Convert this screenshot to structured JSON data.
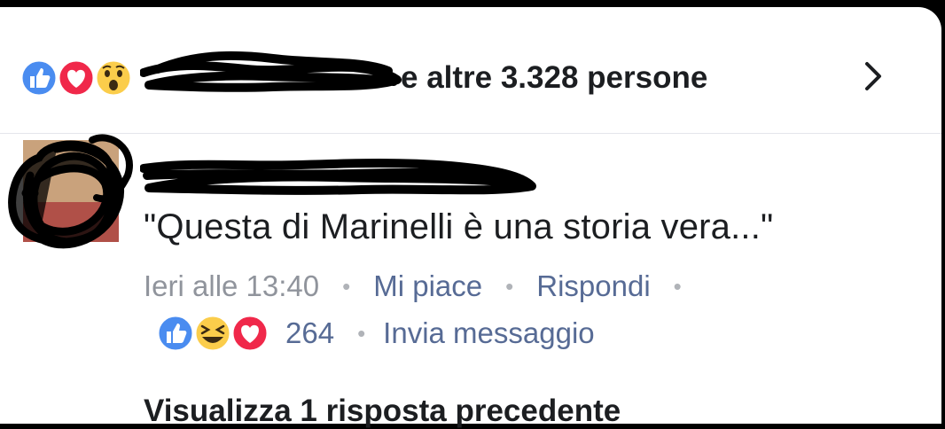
{
  "reactions": {
    "names_text": "e altre 3.328 persone",
    "icons": [
      "like-icon",
      "love-icon",
      "wow-icon"
    ]
  },
  "comment": {
    "text": "\"Questa di Marinelli è una storia vera...\"",
    "time": "Ieri alle 13:40",
    "like_label": "Mi piace",
    "reply_label": "Rispondi",
    "reaction_icons": [
      "like-icon",
      "haha-icon",
      "love-icon"
    ],
    "reaction_count": "264",
    "message_label": "Invia messaggio"
  },
  "replies": {
    "label": "Visualizza 1 risposta precedente"
  },
  "colors": {
    "like_blue": "#4a8cf0",
    "love_red": "#f0284a",
    "wow_yellow": "#fbcd4b",
    "link": "#576b95",
    "meta_gray": "#90949c"
  }
}
